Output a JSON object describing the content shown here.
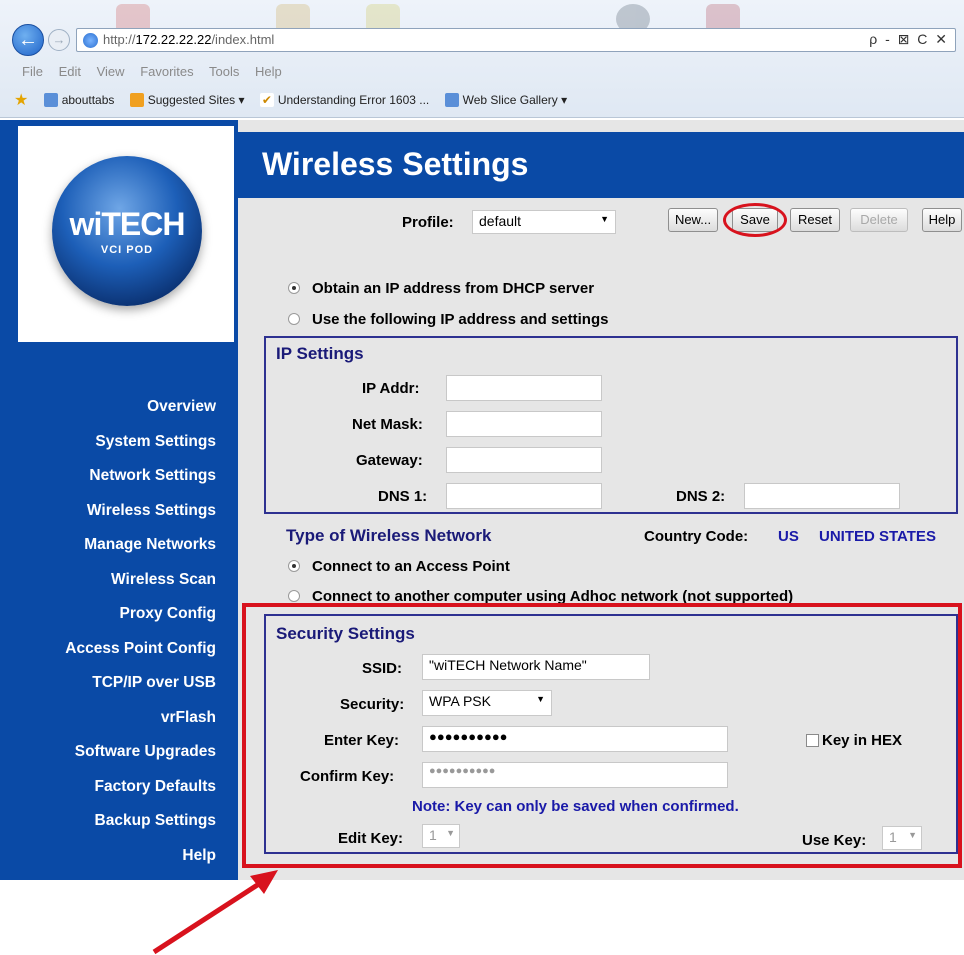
{
  "browser": {
    "url_prefix": "http://",
    "url_host": "172.22.22.22",
    "url_path": "/index.html",
    "address_tools": "ρ - ⊠ C ✕",
    "menu": [
      "File",
      "Edit",
      "View",
      "Favorites",
      "Tools",
      "Help"
    ],
    "favorites": [
      {
        "label": "abouttabs",
        "icon": "page-icon"
      },
      {
        "label": "Suggested Sites ▾",
        "icon": "suggested-sites-icon"
      },
      {
        "label": "Understanding Error 1603 ...",
        "icon": "check-icon"
      },
      {
        "label": "Web Slice Gallery ▾",
        "icon": "page-icon"
      }
    ]
  },
  "logo": {
    "brand": "wiTECH",
    "sub": "VCI POD"
  },
  "sidebar": {
    "items": [
      "Overview",
      "System Settings",
      "Network Settings",
      "Wireless Settings",
      "Manage Networks",
      "Wireless Scan",
      "Proxy Config",
      "Access Point Config",
      "TCP/IP over USB",
      "vrFlash",
      "Software Upgrades",
      "Factory Defaults",
      "Backup Settings",
      "Help"
    ]
  },
  "page": {
    "title": "Wireless Settings",
    "profile_label": "Profile:",
    "profile_value": "default",
    "buttons": {
      "new": "New...",
      "save": "Save",
      "reset": "Reset",
      "delete": "Delete",
      "help": "Help"
    },
    "ip_mode": {
      "dhcp": "Obtain an IP address from DHCP server",
      "static": "Use the following IP address and settings",
      "selected": "dhcp"
    },
    "ip_settings": {
      "title": "IP Settings",
      "ip_addr_label": "IP Addr:",
      "netmask_label": "Net Mask:",
      "gateway_label": "Gateway:",
      "dns1_label": "DNS 1:",
      "dns2_label": "DNS 2:",
      "ip_addr": "",
      "netmask": "",
      "gateway": "",
      "dns1": "",
      "dns2": ""
    },
    "network_type": {
      "title": "Type of Wireless Network",
      "country_label": "Country Code:",
      "country_code": "US",
      "country_name": "UNITED STATES",
      "access_point": "Connect to an Access Point",
      "adhoc": "Connect to another computer using Adhoc network (not supported)",
      "selected": "access_point"
    },
    "security": {
      "title": "Security Settings",
      "ssid_label": "SSID:",
      "ssid": "\"wiTECH Network Name\"",
      "security_label": "Security:",
      "security_value": "WPA PSK",
      "enter_key_label": "Enter Key:",
      "enter_key": "●●●●●●●●●●",
      "key_in_hex_label": "Key in HEX",
      "confirm_key_label": "Confirm Key:",
      "confirm_key": "●●●●●●●●●●",
      "note": "Note: Key can only be saved when confirmed.",
      "edit_key_label": "Edit Key:",
      "edit_key": "1",
      "use_key_label": "Use Key:",
      "use_key": "1"
    }
  },
  "colors": {
    "brand_blue": "#0a4aa6",
    "highlight_red": "#d8121d",
    "fieldset_border": "#2e3191",
    "note_blue": "#1a1aa8"
  }
}
